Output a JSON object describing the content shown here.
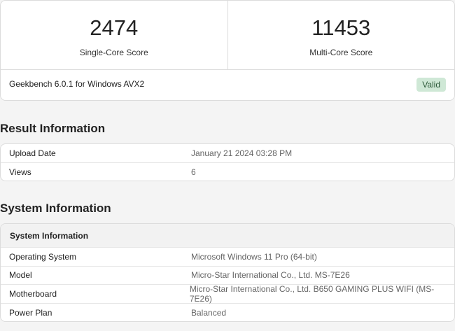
{
  "scores": {
    "single_core_value": "2474",
    "single_core_label": "Single-Core Score",
    "multi_core_value": "11453",
    "multi_core_label": "Multi-Core Score"
  },
  "version": {
    "text": "Geekbench 6.0.1 for Windows AVX2",
    "badge": "Valid",
    "badge_color": "#cfe8d6"
  },
  "result_section": {
    "title": "Result Information",
    "rows": [
      {
        "key": "Upload Date",
        "value": "January 21 2024 03:28 PM"
      },
      {
        "key": "Views",
        "value": "6"
      }
    ]
  },
  "system_section": {
    "title": "System Information",
    "table_header": "System Information",
    "rows": [
      {
        "key": "Operating System",
        "value": "Microsoft Windows 11 Pro (64-bit)"
      },
      {
        "key": "Model",
        "value": "Micro-Star International Co., Ltd. MS-7E26"
      },
      {
        "key": "Motherboard",
        "value": "Micro-Star International Co., Ltd. B650 GAMING PLUS WIFI (MS-7E26)"
      },
      {
        "key": "Power Plan",
        "value": "Balanced"
      }
    ]
  }
}
